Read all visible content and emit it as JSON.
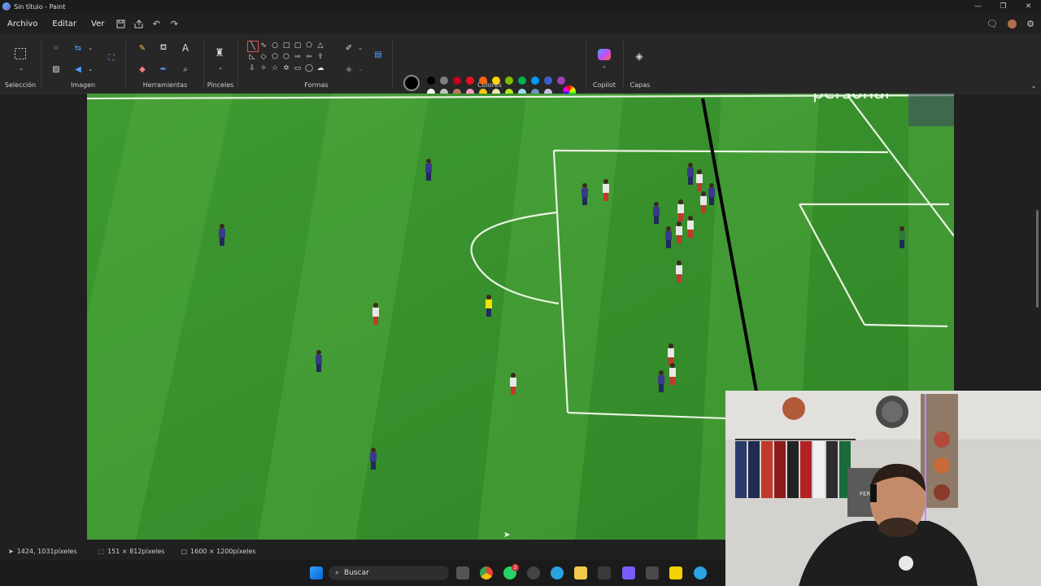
{
  "window": {
    "title": "Sin título - Paint",
    "controls": [
      "minimize",
      "restore",
      "close"
    ]
  },
  "menu": {
    "items": [
      "Archivo",
      "Editar",
      "Ver"
    ],
    "quick_actions": [
      "save-icon",
      "share-icon",
      "undo-icon",
      "redo-icon"
    ]
  },
  "ribbon": {
    "groups": {
      "seleccion": "Selección",
      "imagen": "Imagen",
      "herramientas": "Herramientas",
      "pinceles": "Pinceles",
      "formas": "Formas",
      "colores": "Colores",
      "copilot": "Copilot",
      "capas": "Capas"
    },
    "primary_color": "#000000",
    "secondary_color": "#ffffff",
    "palette_row1": [
      "#000000",
      "#7f7f7f",
      "#c00020",
      "#e81123",
      "#f7630c",
      "#ffd700",
      "#7fba00",
      "#00b050",
      "#0099ff",
      "#3a5fcd",
      "#9b40b6"
    ],
    "palette_row2": [
      "#ffffff",
      "#c3c3c3",
      "#b97a57",
      "#ff9ec0",
      "#ffc90e",
      "#efe4b0",
      "#b5e61d",
      "#99d9ea",
      "#7092be",
      "#c8bfe7"
    ]
  },
  "status": {
    "cursor_pos": "1424, 1031píxeles",
    "selection_size": "151 × 812píxeles",
    "canvas_size": "1600 × 1200píxeles"
  },
  "taskbar": {
    "search_placeholder": "Buscar",
    "badge_count": "2"
  },
  "canvas_image": {
    "watermark_text": "personal"
  },
  "webcam": {
    "shirt_text": "FERN"
  }
}
